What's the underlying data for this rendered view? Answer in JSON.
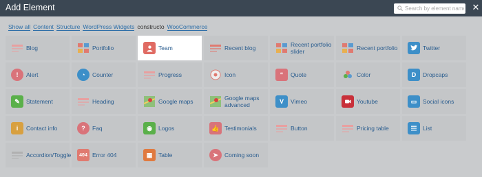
{
  "header": {
    "title": "Add Element",
    "search_placeholder": "Search by element name",
    "close_icon": "close-icon"
  },
  "filters": [
    {
      "label": "Show all",
      "active": false
    },
    {
      "label": "Content",
      "active": false
    },
    {
      "label": "Structure",
      "active": false
    },
    {
      "label": "WordPress Widgets",
      "active": false
    },
    {
      "label": "constructo",
      "active": true
    },
    {
      "label": "WooCommerce",
      "active": false
    }
  ],
  "elements": [
    {
      "label": "Blog",
      "icon": "blog-icon",
      "color": "#e8a0a0"
    },
    {
      "label": "Portfolio",
      "icon": "portfolio-icon",
      "color": "#e07a70"
    },
    {
      "label": "Team",
      "icon": "team-icon",
      "color": "#e06b63",
      "selected": true
    },
    {
      "label": "Recent blog",
      "icon": "recent-blog-icon",
      "color": "#e07a70"
    },
    {
      "label": "Recent portfolio slider",
      "icon": "recent-portfolio-slider-icon",
      "color": "#e07a70"
    },
    {
      "label": "Recent portfolio",
      "icon": "recent-portfolio-icon",
      "color": "#e07a70"
    },
    {
      "label": "Twitter",
      "icon": "twitter-icon",
      "color": "#3d8fc8"
    },
    {
      "label": "Alert",
      "icon": "alert-icon",
      "color": "#d9737a"
    },
    {
      "label": "Counter",
      "icon": "counter-icon",
      "color": "#3d8fc8"
    },
    {
      "label": "Progress",
      "icon": "progress-icon",
      "color": "#e8a0a0"
    },
    {
      "label": "Icon",
      "icon": "icon-icon",
      "color": "#e07a70"
    },
    {
      "label": "Quote",
      "icon": "quote-icon",
      "color": "#d9737a"
    },
    {
      "label": "Color",
      "icon": "color-icon",
      "color": "#d8a040"
    },
    {
      "label": "Dropcaps",
      "icon": "dropcaps-icon",
      "color": "#3d8fc8"
    },
    {
      "label": "Statement",
      "icon": "statement-icon",
      "color": "#5ab04a"
    },
    {
      "label": "Heading",
      "icon": "heading-icon",
      "color": "#e8a0a0"
    },
    {
      "label": "Google maps",
      "icon": "google-maps-icon",
      "color": "#6aa85a"
    },
    {
      "label": "Google maps advanced",
      "icon": "google-maps-advanced-icon",
      "color": "#6aa85a"
    },
    {
      "label": "Vimeo",
      "icon": "vimeo-icon",
      "color": "#3d8fc8"
    },
    {
      "label": "Youtube",
      "icon": "youtube-icon",
      "color": "#c8303a"
    },
    {
      "label": "Social icons",
      "icon": "social-icons-icon",
      "color": "#3d8fc8"
    },
    {
      "label": "Contact info",
      "icon": "contact-info-icon",
      "color": "#d8a040"
    },
    {
      "label": "Faq",
      "icon": "faq-icon",
      "color": "#d9737a"
    },
    {
      "label": "Logos",
      "icon": "logos-icon",
      "color": "#5ab04a"
    },
    {
      "label": "Testimonials",
      "icon": "testimonials-icon",
      "color": "#d9737a"
    },
    {
      "label": "Button",
      "icon": "button-icon",
      "color": "#e8a0a0"
    },
    {
      "label": "Pricing table",
      "icon": "pricing-table-icon",
      "color": "#e8a0a0"
    },
    {
      "label": "List",
      "icon": "list-icon",
      "color": "#3d8fc8"
    },
    {
      "label": "Accordion/Toggle",
      "icon": "accordion-toggle-icon",
      "color": "#b0b0b0"
    },
    {
      "label": "Error 404",
      "icon": "error-404-icon",
      "color": "#e07a70"
    },
    {
      "label": "Table",
      "icon": "table-icon",
      "color": "#e07a40"
    },
    {
      "label": "Coming soon",
      "icon": "coming-soon-icon",
      "color": "#d9737a"
    }
  ]
}
